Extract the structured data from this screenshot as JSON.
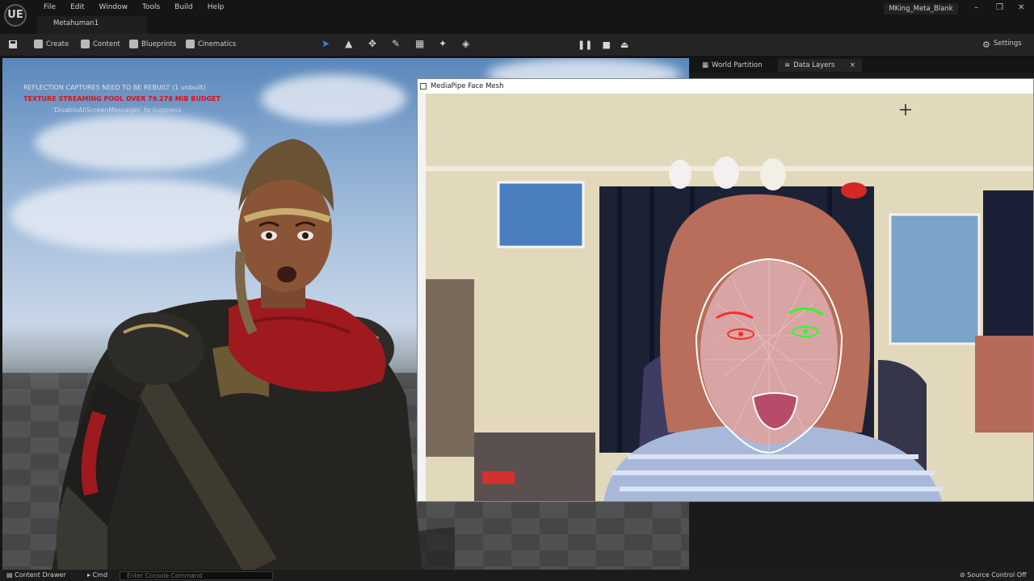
{
  "app": {
    "logo": "UE",
    "menu": [
      "File",
      "Edit",
      "Window",
      "Tools",
      "Build",
      "Help"
    ],
    "level_tab": "Metahuman1",
    "project_name": "MKing_Meta_Blank",
    "window_controls": [
      "–",
      "❐",
      "✕"
    ]
  },
  "toolbar": {
    "save_icon": "save-icon",
    "create_label": "Create",
    "content_label": "Content",
    "blueprints_label": "Blueprints",
    "cinematics_label": "Cinematics",
    "settings_label": "Settings"
  },
  "viewport": {
    "messages": {
      "reflection": "REFLECTION CAPTURES NEED TO BE REBUILT (1 unbuilt)",
      "texture_pool": "TEXTURE STREAMING POOL OVER 79.278 MiB BUDGET",
      "suppress_hint": "'DisableAllScreenMessages' to suppress"
    },
    "colors": {
      "warning": "#d2141e",
      "sky": "#86a9d0",
      "cloth_red": "#9e1a1f"
    }
  },
  "panels": {
    "world_partition": "World Partition",
    "data_layers": "Data Layers",
    "close": "×"
  },
  "mediapipe": {
    "window_title": "MediaPipe Face Mesh",
    "colors": {
      "right_eye": "#ff2a2a",
      "left_eye": "#2aff2a",
      "mesh": "#ffffff"
    }
  },
  "statusbar": {
    "content_drawer": "Content Drawer",
    "cmd": "Cmd",
    "console_placeholder": "Enter Console Command",
    "source_control": "Source Control Off"
  }
}
